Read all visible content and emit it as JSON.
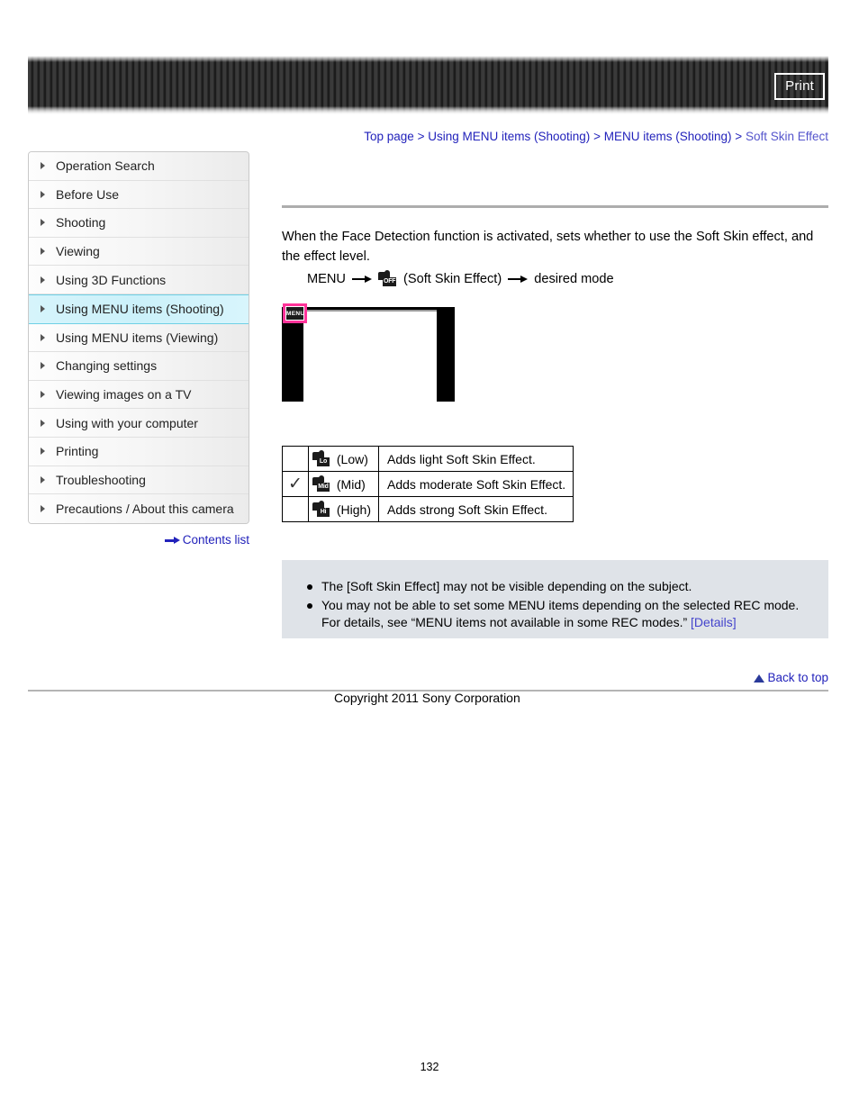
{
  "header": {
    "print_label": "Print"
  },
  "breadcrumb": {
    "items": [
      {
        "label": "Top page",
        "current": false
      },
      {
        "label": "Using MENU items (Shooting)",
        "current": false
      },
      {
        "label": "MENU items (Shooting)",
        "current": false
      },
      {
        "label": "Soft Skin Effect",
        "current": true
      }
    ],
    "separator": ">"
  },
  "sidebar": {
    "items": [
      {
        "label": "Operation Search",
        "selected": false
      },
      {
        "label": "Before Use",
        "selected": false
      },
      {
        "label": "Shooting",
        "selected": false
      },
      {
        "label": "Viewing",
        "selected": false
      },
      {
        "label": "Using 3D Functions",
        "selected": false
      },
      {
        "label": "Using MENU items (Shooting)",
        "selected": true
      },
      {
        "label": "Using MENU items (Viewing)",
        "selected": false
      },
      {
        "label": "Changing settings",
        "selected": false
      },
      {
        "label": "Viewing images on a TV",
        "selected": false
      },
      {
        "label": "Using with your computer",
        "selected": false
      },
      {
        "label": "Printing",
        "selected": false
      },
      {
        "label": "Troubleshooting",
        "selected": false
      },
      {
        "label": "Precautions / About this camera",
        "selected": false
      }
    ],
    "contents_list_label": "Contents list"
  },
  "main": {
    "intro_text": "When the Face Detection function is activated, sets whether to use the Soft Skin effect, and the effect level.",
    "menu_path": {
      "start_label": "MENU",
      "icon_tag": "OFF",
      "icon_label": "(Soft Skin Effect)",
      "end_label": "desired mode"
    },
    "illustration": {
      "badge_label": "MENU",
      "badge_color": "#ff3399"
    },
    "options_table": {
      "rows": [
        {
          "selected": false,
          "check": "",
          "icon_tag": "Lo",
          "label": "(Low)",
          "description": "Adds light Soft Skin Effect."
        },
        {
          "selected": true,
          "check": "✓",
          "icon_tag": "Mid",
          "label": "(Mid)",
          "description": "Adds moderate Soft Skin Effect."
        },
        {
          "selected": false,
          "check": "",
          "icon_tag": "Hi",
          "label": "(High)",
          "description": "Adds strong Soft Skin Effect."
        }
      ]
    },
    "notes": {
      "items": [
        {
          "text": "The [Soft Skin Effect] may not be visible depending on the subject.",
          "link": ""
        },
        {
          "text": "You may not be able to set some MENU items depending on the selected REC mode. For details, see “MENU items not available in some REC modes.” ",
          "link": "[Details]"
        }
      ]
    }
  },
  "footer": {
    "back_to_top_label": "Back to top",
    "copyright": "Copyright 2011 Sony Corporation",
    "page_number": "132"
  }
}
